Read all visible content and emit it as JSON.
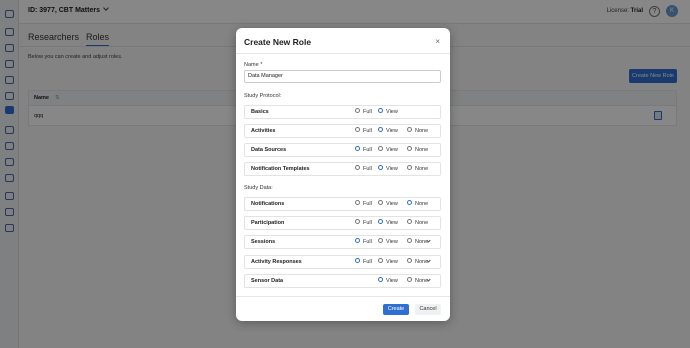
{
  "header": {
    "study_label": "ID: 3977, CBT Matters",
    "license_label": "License:",
    "license_value": "Trial",
    "help_glyph": "?",
    "avatar_initial": "K"
  },
  "tabs": [
    {
      "label": "Researchers"
    },
    {
      "label": "Roles"
    }
  ],
  "page": {
    "description": "Below you can create and adjust roles.",
    "create_button": "Create New Role"
  },
  "table": {
    "columns": [
      "Name"
    ],
    "rows": [
      {
        "name": "qqq"
      }
    ]
  },
  "modal": {
    "title": "Create New Role",
    "close_glyph": "×",
    "name_label": "Name *",
    "name_value": "Data Manager",
    "study_protocol_label": "Study Protocol:",
    "study_data_label": "Study Data:",
    "option_labels": {
      "full": "Full",
      "view": "View",
      "none": "None"
    },
    "protocol_rows": [
      {
        "name": "Basics",
        "options": [
          "Full",
          "View"
        ],
        "selected": "View"
      },
      {
        "name": "Activities",
        "options": [
          "Full",
          "View",
          "None"
        ],
        "selected": "View"
      },
      {
        "name": "Data Sources",
        "options": [
          "Full",
          "View",
          "None"
        ],
        "selected": "Full"
      },
      {
        "name": "Notification Templates",
        "options": [
          "Full",
          "View",
          "None"
        ],
        "selected": "View"
      }
    ],
    "data_rows": [
      {
        "name": "Notifications",
        "options": [
          "Full",
          "View",
          "None"
        ],
        "selected": "None",
        "expandable": false
      },
      {
        "name": "Participation",
        "options": [
          "Full",
          "View",
          "None"
        ],
        "selected": "View",
        "expandable": false
      },
      {
        "name": "Sessions",
        "options": [
          "Full",
          "View",
          "None"
        ],
        "selected": "Full",
        "expandable": true
      },
      {
        "name": "Activity Responses",
        "options": [
          "Full",
          "View",
          "None"
        ],
        "selected": "Full",
        "expandable": true
      },
      {
        "name": "Sensor Data",
        "options": [
          "View",
          "None"
        ],
        "selected": "View",
        "expandable": true
      }
    ],
    "create_button": "Create",
    "cancel_button": "Cancel"
  },
  "colors": {
    "accent": "#2e6fd1",
    "overlay": "rgba(0,0,0,0.47)"
  }
}
